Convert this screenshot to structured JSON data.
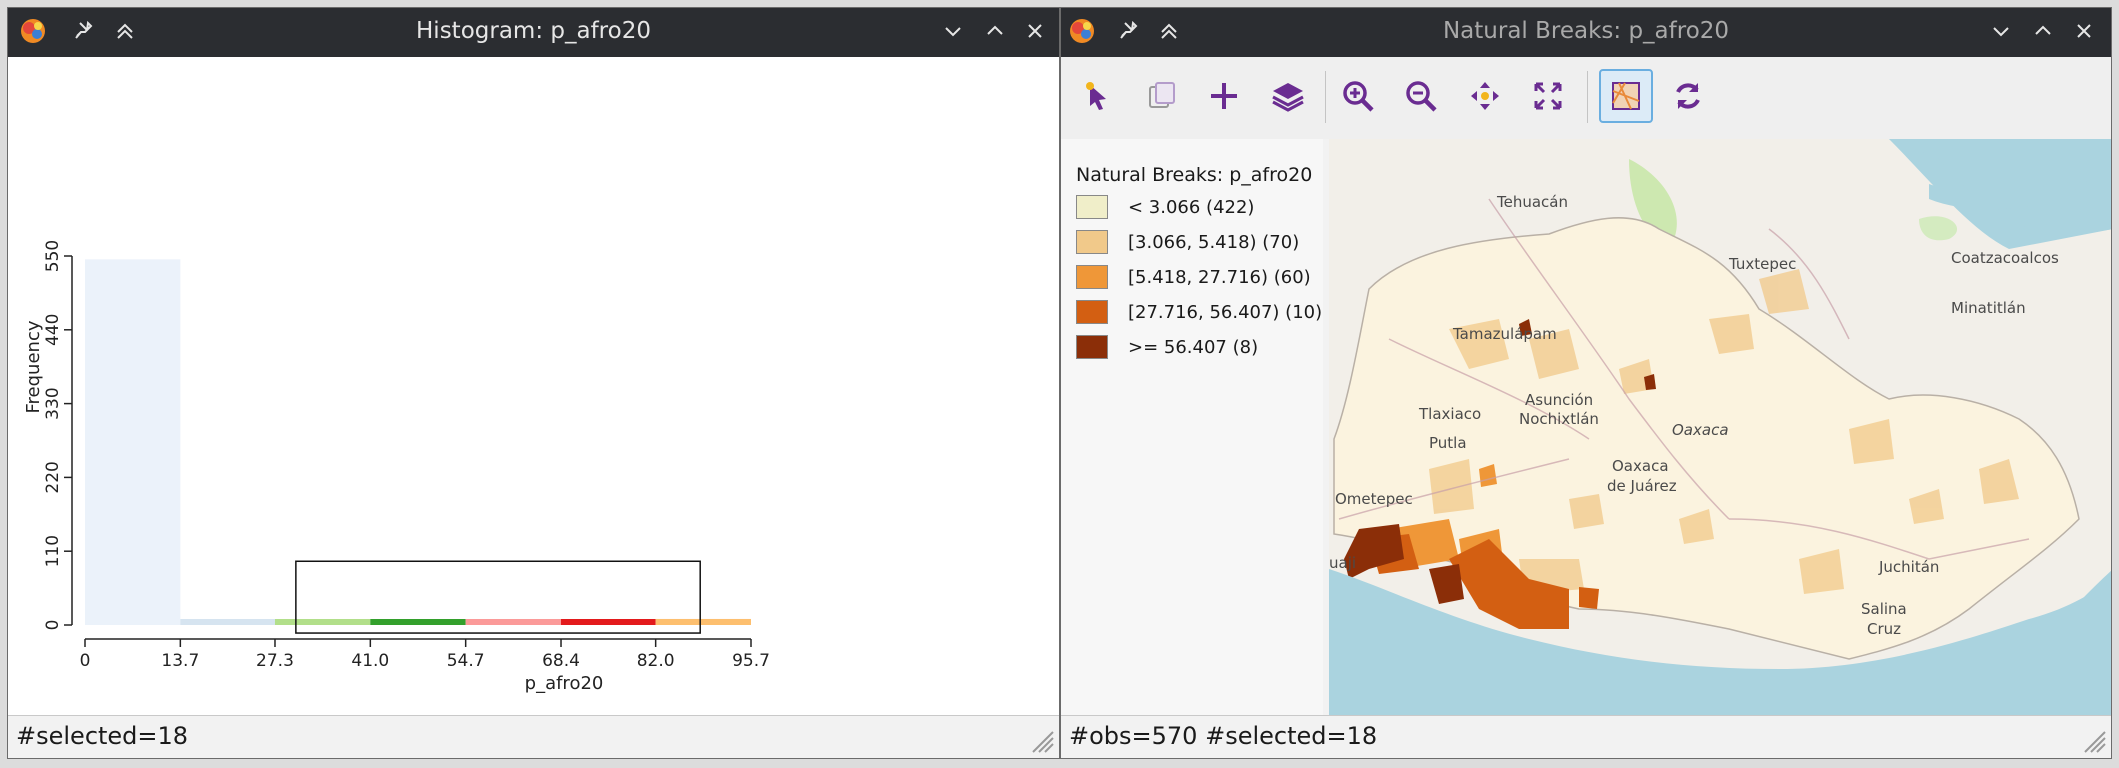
{
  "histogram_window": {
    "title": "Histogram: p_afro20",
    "status": "#selected=18"
  },
  "map_window": {
    "title": "Natural Breaks: p_afro20",
    "status": "#obs=570 #selected=18",
    "toolbar": [
      "select-tool",
      "copy-image",
      "add-layer",
      "layers",
      "zoom-in",
      "zoom-out",
      "pan",
      "full-extent",
      "basemap-toggle",
      "refresh"
    ],
    "legend": {
      "title": "Natural Breaks: p_afro20",
      "items": [
        {
          "label": "< 3.066 (422)",
          "color": "#f0eec9"
        },
        {
          "label": "[3.066, 5.418) (70)",
          "color": "#f1c98a"
        },
        {
          "label": "[5.418, 27.716) (60)",
          "color": "#ef9738"
        },
        {
          "label": "[27.716, 56.407) (10)",
          "color": "#d35f12"
        },
        {
          "label": ">= 56.407 (8)",
          "color": "#8b2e08"
        }
      ]
    },
    "map_labels": [
      "Tehuacán",
      "Tuxtepec",
      "Coatzacoalcos",
      "Minatitlán",
      "Tamazulápam",
      "Tlaxiaco",
      "Asunción",
      "Nochixtlán",
      "Putla",
      "Oaxaca",
      "Oaxaca",
      "de Juárez",
      "Ometepec",
      "uaji",
      "Juchitán",
      "Salina",
      "Cruz"
    ]
  },
  "chart_data": {
    "type": "bar",
    "title": "",
    "xlabel": "p_afro20",
    "ylabel": "Frequency",
    "x_ticks": [
      "0",
      "13.7",
      "27.3",
      "41.0",
      "54.7",
      "68.4",
      "82.0",
      "95.7"
    ],
    "y_ticks": [
      "0",
      "110",
      "220",
      "330",
      "440",
      "550"
    ],
    "ylim": [
      0,
      550
    ],
    "bins": [
      {
        "range": [
          0,
          13.7
        ],
        "value": 545,
        "color": "#ebf2fa"
      },
      {
        "range": [
          13.7,
          27.3
        ],
        "value": 8,
        "color": "#d6e4f0"
      },
      {
        "range": [
          27.3,
          41.0
        ],
        "value": 8,
        "color": "#b2df8a"
      },
      {
        "range": [
          41.0,
          54.7
        ],
        "value": 5,
        "color": "#33a02c"
      },
      {
        "range": [
          54.7,
          68.4
        ],
        "value": 5,
        "color": "#fb9a99"
      },
      {
        "range": [
          68.4,
          82.0
        ],
        "value": 3,
        "color": "#e31a1c"
      },
      {
        "range": [
          82.0,
          95.7
        ],
        "value": 9,
        "color": "#fdbf6f"
      }
    ],
    "selection_box": {
      "x_range": [
        30.3,
        88.4
      ],
      "y_range": [
        -12,
        95
      ]
    }
  }
}
